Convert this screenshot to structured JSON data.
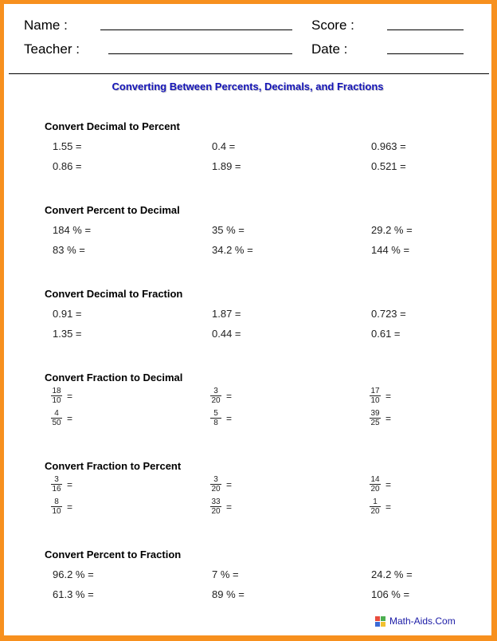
{
  "header": {
    "name_label": "Name :",
    "teacher_label": "Teacher :",
    "score_label": "Score :",
    "date_label": "Date :"
  },
  "title": "Converting Between Percents, Decimals, and Fractions",
  "sections": [
    {
      "title": "Convert Decimal to Percent",
      "problems": [
        "1.55 =",
        "0.4 =",
        "0.963 =",
        "0.86 =",
        "1.89 =",
        "0.521 ="
      ]
    },
    {
      "title": "Convert Percent to Decimal",
      "problems": [
        "184 % =",
        "35 % =",
        "29.2 % =",
        "83 % =",
        "34.2 % =",
        "144 % ="
      ]
    },
    {
      "title": "Convert Decimal to Fraction",
      "problems": [
        "0.91 =",
        "1.87 =",
        "0.723 =",
        "1.35 =",
        "0.44 =",
        "0.61 ="
      ]
    },
    {
      "title": "Convert Fraction to Decimal",
      "fractions": [
        {
          "num": "18",
          "den": "10"
        },
        {
          "num": "3",
          "den": "20"
        },
        {
          "num": "17",
          "den": "10"
        },
        {
          "num": "4",
          "den": "50"
        },
        {
          "num": "5",
          "den": "8"
        },
        {
          "num": "39",
          "den": "25"
        }
      ],
      "eq": "="
    },
    {
      "title": "Convert Fraction to Percent",
      "fractions": [
        {
          "num": "3",
          "den": "16"
        },
        {
          "num": "3",
          "den": "20"
        },
        {
          "num": "14",
          "den": "20"
        },
        {
          "num": "8",
          "den": "10"
        },
        {
          "num": "33",
          "den": "20"
        },
        {
          "num": "1",
          "den": "20"
        }
      ],
      "eq": "="
    },
    {
      "title": "Convert Percent to Fraction",
      "problems": [
        "96.2 % =",
        "7 % =",
        "24.2 % =",
        "61.3 % =",
        "89 % =",
        "106 % ="
      ]
    }
  ],
  "footer": {
    "logo_text": "Math-Aids.Com",
    "logo_icon": "math-aids-logo-icon"
  },
  "colors": {
    "border": "#f7901e",
    "title": "#1515b8",
    "logo_text": "#1a1aa6"
  }
}
